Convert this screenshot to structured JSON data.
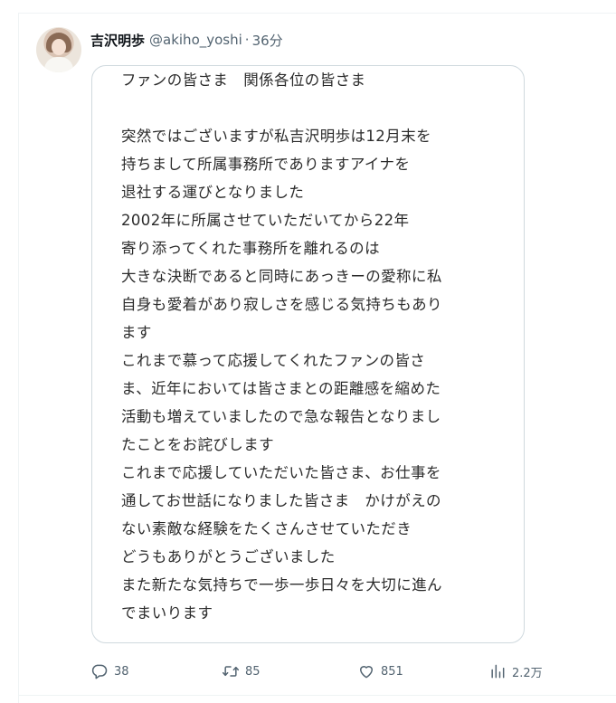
{
  "post": {
    "author": {
      "display_name": "吉沢明歩",
      "handle": "@akiho_yoshi",
      "separator": "·",
      "time": "36分"
    },
    "image_text": {
      "lines": [
        "ファンの皆さま　関係各位の皆さま",
        "",
        "突然ではございますが私吉沢明歩は12月末を",
        "持ちまして所属事務所でありますアイナを",
        "退社する運びとなりました",
        "2002年に所属させていただいてから22年",
        "寄り添ってくれた事務所を離れるのは",
        "大きな決断であると同時にあっきーの愛称に私",
        "自身も愛着があり寂しさを感じる気持ちもあり",
        "ます",
        "これまで慕って応援してくれたファンの皆さ",
        "ま、近年においては皆さまとの距離感を縮めた",
        "活動も増えていましたので急な報告となりまし",
        "たことをお詫びします",
        "これまで応援していただいた皆さま、お仕事を",
        "通してお世話になりました皆さま　かけがえの",
        "ない素敵な経験をたくさんさせていただき",
        "どうもありがとうございました",
        "また新たな気持ちで一歩一歩日々を大切に進ん",
        "でまいります"
      ]
    },
    "actions": {
      "reply_count": "38",
      "repost_count": "85",
      "like_count": "851",
      "view_count": "2.2万"
    }
  },
  "icons": {
    "reply": "reply-icon",
    "repost": "repost-icon",
    "like": "like-icon",
    "views": "views-icon"
  }
}
